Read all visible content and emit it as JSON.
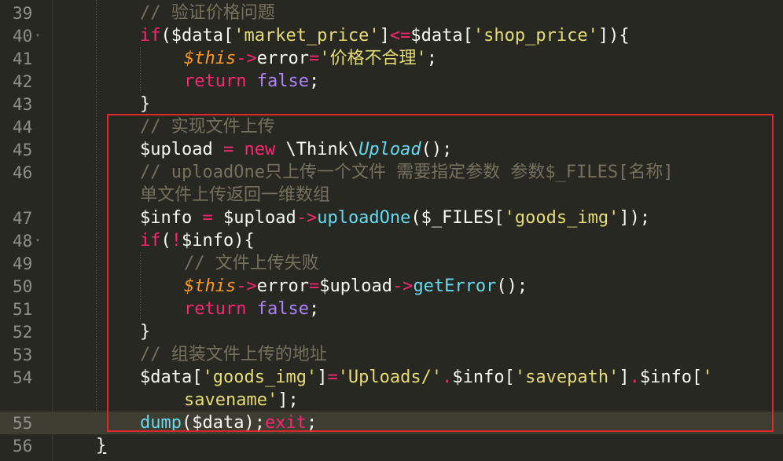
{
  "editor": {
    "highlight_color": "#e0272c",
    "current_line": 55,
    "line_numbers": [
      "39",
      "40",
      "41",
      "42",
      "43",
      "44",
      "45",
      "46",
      "47",
      "48",
      "49",
      "50",
      "51",
      "52",
      "53",
      "54",
      "55",
      "56"
    ],
    "fold_marker": "▾"
  },
  "code": {
    "l39": {
      "t1": "// 验证价格问题"
    },
    "l40": {
      "t1": "if",
      "t2": "($data[",
      "t3": "'market_price'",
      "t4": "]",
      "t5": "<=",
      "t6": "$data[",
      "t7": "'shop_price'",
      "t8": "]){"
    },
    "l41": {
      "t1": "$this",
      "t2": "->",
      "t3": "error",
      "t4": "=",
      "t5": "'价格不合理'",
      "t6": ";"
    },
    "l42": {
      "t1": "return",
      "t2": " ",
      "t3": "false",
      "t4": ";"
    },
    "l43": {
      "t1": "}"
    },
    "l44": {
      "t1": "// 实现文件上传"
    },
    "l45": {
      "t1": "$upload ",
      "t2": "=",
      "t3": " ",
      "t4": "new",
      "t5": " \\Think\\",
      "t6": "Upload",
      "t7": "();"
    },
    "l46": {
      "t1": "// uploadOne只上传一个文件 需要指定参数 参数$_FILES[名称]",
      "t2": "单文件上传返回一维数组"
    },
    "l47": {
      "t1": "$info ",
      "t2": "=",
      "t3": " $upload",
      "t4": "->",
      "t5": "uploadOne",
      "t6": "($_FILES[",
      "t7": "'goods_img'",
      "t8": "]);"
    },
    "l48": {
      "t1": "if",
      "t2": "(",
      "t3": "!",
      "t4": "$info){"
    },
    "l49": {
      "t1": "// 文件上传失败"
    },
    "l50": {
      "t1": "$this",
      "t2": "->",
      "t3": "error",
      "t4": "=",
      "t5": "$upload",
      "t6": "->",
      "t7": "getError",
      "t8": "();"
    },
    "l51": {
      "t1": "return",
      "t2": " ",
      "t3": "false",
      "t4": ";"
    },
    "l52": {
      "t1": "}"
    },
    "l53": {
      "t1": "// 组装文件上传的地址"
    },
    "l54": {
      "t1": "$data[",
      "t2": "'goods_img'",
      "t3": "]",
      "t4": "=",
      "t5": "'Uploads/'",
      "t6": ".",
      "t7": "$info[",
      "t8": "'savepath'",
      "t9": "]",
      "t10": ".",
      "t11": "$info[",
      "t12": "'",
      "t13": "savename'",
      "t14": "];"
    },
    "l55": {
      "t1": "dump",
      "t2": "($data);",
      "t3": "exit",
      "t4": ";"
    },
    "l56": {
      "t1": "}"
    }
  }
}
